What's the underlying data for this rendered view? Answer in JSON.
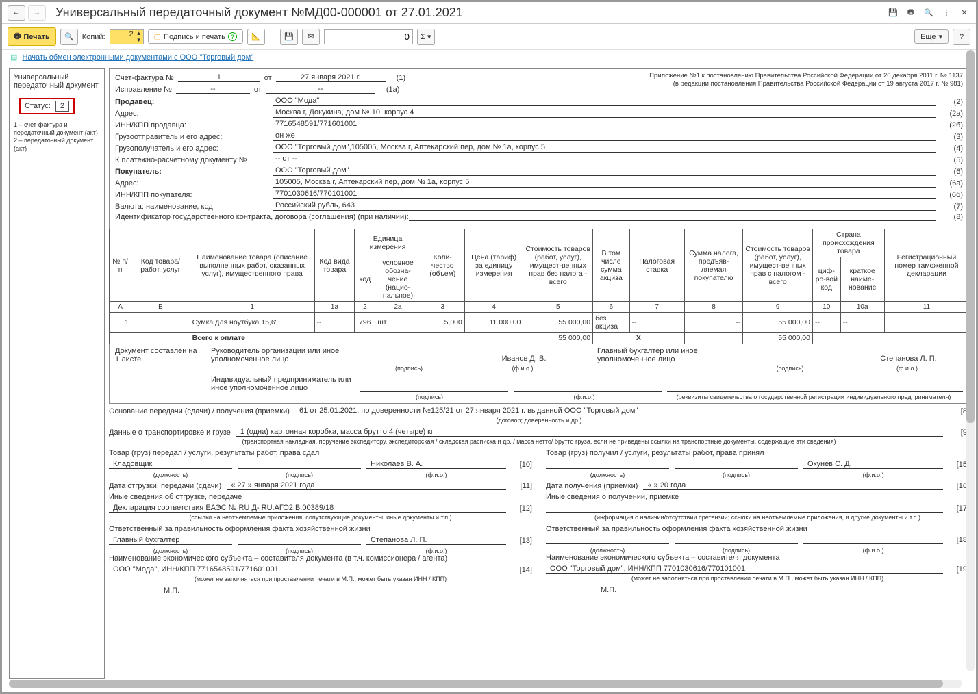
{
  "titlebar": {
    "title": "Универсальный передаточный документ №МД00-000001 от 27.01.2021"
  },
  "toolbar": {
    "print": "Печать",
    "copies_label": "Копий:",
    "copies_value": "2",
    "sign_print": "Подпись и печать",
    "zero": "0",
    "more": "Еще"
  },
  "link": "Начать обмен электронными документами с ООО \"Торговый дом\"",
  "left_panel": {
    "title": "Универсальный передаточный документ",
    "status_label": "Статус:",
    "status_value": "2",
    "note": "1 – счет-фактура и передаточный документ (акт)\n2 – передаточный документ (акт)"
  },
  "header": {
    "invoice_label": "Счет-фактура №",
    "invoice_no": "1",
    "from_label": "от",
    "invoice_date": "27 января 2021 г.",
    "code1": "(1)",
    "correction_label": "Исправление №",
    "correction_no": "--",
    "correction_date": "--",
    "code1a": "(1а)",
    "note1": "Приложение №1 к постановлению Правительства Российской Федерации от 26 декабря 2011 г. № 1137",
    "note2": "(в редакции постановления Правительства Российской Федерации от 19 августа 2017 г. № 981)",
    "rows": [
      {
        "label": "Продавец:",
        "value": "ООО \"Мода\"",
        "code": "(2)",
        "bold": true
      },
      {
        "label": "Адрес:",
        "value": "Москва г, Докукина, дом № 10, корпус 4",
        "code": "(2а)"
      },
      {
        "label": "ИНН/КПП продавца:",
        "value": "7716548591/771601001",
        "code": "(2б)"
      },
      {
        "label": "Грузоотправитель и его адрес:",
        "value": "он же",
        "code": "(3)"
      },
      {
        "label": "Грузополучатель и его адрес:",
        "value": "ООО \"Торговый дом\",105005, Москва г, Аптекарский пер, дом № 1а, корпус 5",
        "code": "(4)"
      },
      {
        "label": "К платежно-расчетному документу №",
        "value": "-- от --",
        "code": "(5)"
      },
      {
        "label": "Покупатель:",
        "value": "ООО \"Торговый дом\"",
        "code": "(6)",
        "bold": true
      },
      {
        "label": "Адрес:",
        "value": "105005, Москва г, Аптекарский пер, дом № 1а, корпус 5",
        "code": "(6а)"
      },
      {
        "label": "ИНН/КПП покупателя:",
        "value": "7701030616/770101001",
        "code": "(6б)"
      },
      {
        "label": "Валюта: наименование, код",
        "value": "Российский рубль, 643",
        "code": "(7)"
      },
      {
        "label": "Идентификатор государственного контракта, договора (соглашения) (при наличии):",
        "value": "",
        "code": "(8)",
        "wide": true
      }
    ]
  },
  "table": {
    "headers": {
      "h1": "№ п/п",
      "h2": "Код товара/ работ, услуг",
      "h3": "Наименование товара (описание выполненных работ, оказанных услуг), имущественного права",
      "h4": "Код вида товара",
      "h5": "Единица измерения",
      "h5a": "код",
      "h5b": "условное обозна-чение (нацио-нальное)",
      "h6": "Коли-чество (объем)",
      "h7": "Цена (тариф) за единицу измерения",
      "h8": "Стоимость товаров (работ, услуг), имущест-венных прав без налога - всего",
      "h9": "В том числе сумма акциза",
      "h10": "Налоговая ставка",
      "h11": "Сумма налога, предъяв-ляемая покупателю",
      "h12": "Стоимость товаров (работ, услуг), имущест-венных прав с налогом - всего",
      "h13": "Страна происхождения товара",
      "h13a": "циф-ро-вой код",
      "h13b": "краткое наиме-нование",
      "h14": "Регистрационный номер таможенной декларации"
    },
    "numrow": [
      "А",
      "Б",
      "1",
      "1а",
      "2",
      "2а",
      "3",
      "4",
      "5",
      "6",
      "7",
      "8",
      "9",
      "10",
      "10а",
      "11"
    ],
    "row1": {
      "n": "1",
      "code": "",
      "name": "Сумка для ноутбука 15,6\"",
      "vid": "--",
      "ucode": "796",
      "uname": "шт",
      "qty": "5,000",
      "price": "11 000,00",
      "sum": "55 000,00",
      "excise": "без акциза",
      "rate": "--",
      "tax": "--",
      "total": "55 000,00",
      "country_code": "--",
      "country": "--",
      "decl": ""
    },
    "total_row": {
      "label": "Всего к оплате",
      "sum": "55 000,00",
      "tax_x": "X",
      "tax": "",
      "total": "55 000,00"
    }
  },
  "sigblock": {
    "doc_pages": "Документ составлен на 1 листе",
    "head_label": "Руководитель организации или иное уполномоченное лицо",
    "head_name": "Иванов Д. В.",
    "acc_label": "Главный бухгалтер или иное уполномоченное лицо",
    "acc_name": "Степанова Л. П.",
    "ip_label": "Индивидуальный предприниматель или иное уполномоченное лицо",
    "sub_sign": "(подпись)",
    "sub_fio": "(ф.и.о.)",
    "ip_note": "(реквизиты свидетельства о государственной регистрации индивидуального предпринимателя)"
  },
  "bottom": {
    "b8_label": "Основание передачи (сдачи) / получения (приемки)",
    "b8_value": "61 от 25.01.2021; по доверенности №125/21 от 27 января 2021 г. выданной ООО \"Торговый дом\"",
    "b8_note": "(договор; доверенность и др.)",
    "b9_label": "Данные о транспортировке и грузе",
    "b9_value": "1 (одна) картонная коробка, масса брутто 4 (четыре) кг",
    "b9_note": "(транспортная накладная, поручение экспедитору, экспедиторская / складская расписка и др. / масса нетто/ брутто груза, если не приведены ссылки на транспортные документы, содержащие эти сведения)",
    "left": {
      "b10_title": "Товар (груз) передал / услуги, результаты работ, права сдал",
      "b10_pos": "Кладовщик",
      "b10_name": "Николаев В. А.",
      "b11_label": "Дата отгрузки, передачи (сдачи)",
      "b11_date": "« 27 »   января   2021   года",
      "b12_label": "Иные сведения об отгрузке, передаче",
      "b12_value": "Декларация соответствия ЕАЭС № RU Д- RU.АГО2.В.00389/18",
      "b12_note": "(ссылки на неотъемлемые приложения, сопутствующие документы, иные документы и т.п.)",
      "b13_label": "Ответственный за правильность оформления факта хозяйственной жизни",
      "b13_pos": "Главный бухгалтер",
      "b13_name": "Степанова Л. П.",
      "b14_label": "Наименование экономического субъекта – составителя документа (в т.ч. комиссионера / агента)",
      "b14_value": "ООО \"Мода\", ИНН/КПП 7716548591/771601001",
      "b14_note": "(может не заполняться при проставлении печати в М.П., может быть указан ИНН / КПП)",
      "mp": "М.П."
    },
    "right": {
      "b15_title": "Товар (груз) получил / услуги, результаты работ, права принял",
      "b15_name": "Окунев С. Д.",
      "b16_label": "Дата получения (приемки)",
      "b16_date": "«        »                      20       года",
      "b17_label": "Иные сведения о получении, приемке",
      "b17_note": "(информация о наличии/отсутствии претензии; ссылки на неотъемлемые приложения, и другие документы и т.п.)",
      "b18_label": "Ответственный за правильность оформления факта хозяйственной жизни",
      "b19_label": "Наименование экономического субъекта – составителя документа",
      "b19_value": "ООО \"Торговый дом\", ИНН/КПП 7701030616/770101001",
      "b19_note": "(может не заполняться при проставлении печати в М.П., может быть указан ИНН / КПП)",
      "mp": "М.П."
    },
    "sub_pos": "(должность)",
    "sub_sign": "(подпись)",
    "sub_fio": "(ф.и.о.)"
  }
}
